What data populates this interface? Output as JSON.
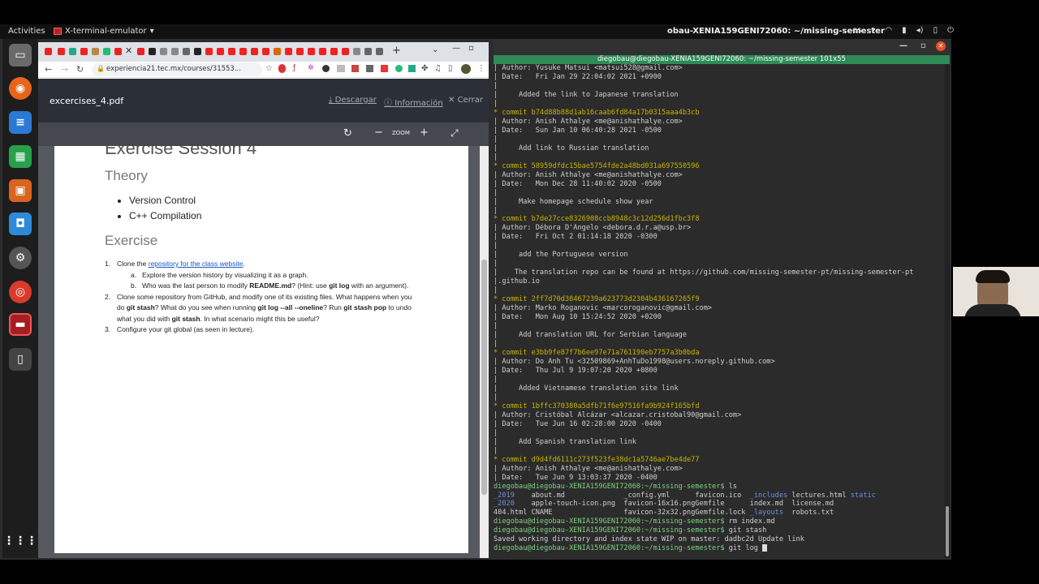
{
  "topbar": {
    "activities": "Activities",
    "app_name": "X-terminal-emulator",
    "terminal_title": "obau-XENIA159GENI72060: ~/missing-semester",
    "lang": "es"
  },
  "browser": {
    "url": "experiencia21.tec.mx/courses/31553...",
    "pdf": {
      "filename": "excercises_4.pdf",
      "download": "Descargar",
      "info": "Información",
      "close": "Cerrar",
      "zoom": "ZOOM",
      "page": {
        "session_title": "Exercise Session 4",
        "theory_heading": "Theory",
        "theory_items": [
          "Version Control",
          "C++ Compilation"
        ],
        "exercise_heading": "Exercise",
        "ex1_prefix": "Clone the ",
        "ex1_link": "repository for the class website",
        "ex1_suffix": ".",
        "ex1a": "Explore the version history by visualizing it as a graph.",
        "ex1b_pre": "Who was the last person to modify ",
        "ex1b_bold": "README.md",
        "ex1b_mid": "? (Hint: use ",
        "ex1b_bold2": "git log",
        "ex1b_post": " with an argument).",
        "ex2_a": "Clone some repository from GitHub, and modify one of its existing files. What happens when you do ",
        "ex2_b": "git stash",
        "ex2_c": "? What do you see when running ",
        "ex2_d": "git log --all --oneline",
        "ex2_e": "? Run ",
        "ex2_f": "git stash pop",
        "ex2_g": " to undo what you did with ",
        "ex2_h": "git stash",
        "ex2_i": ". In what scenario might this be useful?",
        "ex3": "Configure your git global (as seen in lecture)."
      }
    }
  },
  "terminal": {
    "tab_title": "diegobau@diegobau-XENIA159GENI72060: ~/missing-semester 101x55",
    "log": [
      {
        "author": "Yusuke Matsui <matsui528@gmail.com>",
        "date": "Fri Jan 29 22:04:02 2021 +0900",
        "message": "Added the link to Japanese translation",
        "head_only": true
      },
      {
        "commit": "b74d88b88d1ab16caab6fd84a17b0315aaa4b3cb",
        "author": "Anish Athalye <me@anishathalye.com>",
        "date": "Sun Jan 10 06:40:28 2021 -0500",
        "message": "Add link to Russian translation"
      },
      {
        "commit": "58959dfdc15bae5754fde2a48bd031a697550596",
        "author": "Anish Athalye <me@anishathalye.com>",
        "date": "Mon Dec 28 11:40:02 2020 -0500",
        "message": "Make homepage schedule show year"
      },
      {
        "commit": "b7de27cce8326908ccb8948c3c12d256d1fbc3f8",
        "author": "Débora D'Angelo <debora.d.r.a@usp.br>",
        "date": "Fri Oct 2 01:14:18 2020 -0300",
        "message": "add the Portuguese version",
        "extra": [
          "",
          "    The translation repo can be found at https://github.com/missing-semester-pt/missing-semester-pt",
          ".github.io"
        ]
      },
      {
        "commit": "2ff7d70d38467239a623773d2304b436167265f9",
        "author": "Marko Roganovic <marcoroganovic@gmail.com>",
        "date": "Mon Aug 10 15:24:52 2020 +0200",
        "message": "Add translation URL for Serbian language"
      },
      {
        "commit": "e3bb9fe87f7b6ee97e71a761190eb7757a3b0bda",
        "author": "Do Anh Tu <32509869+AnhTuDo1998@users.noreply.github.com>",
        "date": "Thu Jul 9 19:07:20 2020 +0800",
        "message": "Added Vietnamese translation site link"
      },
      {
        "commit": "1bffc370380a5dfb71f6e97516fa9b924f165bfd",
        "author": "Cristóbal Alcázar <alcazar.cristobal90@gmail.com>",
        "date": "Tue Jun 16 02:28:00 2020 -0400",
        "message": "Add Spanish translation link"
      },
      {
        "commit": "d9d4fd6111c273f523fe38dc1a5746ae7be4de77",
        "author": "Anish Athalye <me@anishathalye.com>",
        "date": "Tue Jun 9 13:03:37 2020 -0400",
        "message": "",
        "no_message": true
      }
    ],
    "prompt": "diegobau@diegobau-XENIA159GENI72060:~/missing-semester$",
    "commands": [
      "ls",
      "rm index.md",
      "git stash",
      "git log"
    ],
    "ls_rows": [
      [
        {
          "t": "_2019",
          "c": "blue"
        },
        {
          "t": "about.md"
        },
        {
          "t": "_config.yml"
        },
        {
          "t": "favicon.ico"
        },
        {
          "t": "_includes",
          "c": "blue"
        },
        {
          "t": "lectures.html"
        },
        {
          "t": "static",
          "c": "blue"
        }
      ],
      [
        {
          "t": "_2020",
          "c": "blue"
        },
        {
          "t": "apple-touch-icon.png"
        },
        {
          "t": "favicon-16x16.png"
        },
        {
          "t": "Gemfile"
        },
        {
          "t": "index.md"
        },
        {
          "t": "license.md"
        },
        {
          "t": ""
        }
      ],
      [
        {
          "t": "404.html"
        },
        {
          "t": "CNAME"
        },
        {
          "t": "favicon-32x32.png"
        },
        {
          "t": "Gemfile.lock"
        },
        {
          "t": "_layouts",
          "c": "blue"
        },
        {
          "t": "robots.txt"
        },
        {
          "t": ""
        }
      ]
    ],
    "stash_output": "Saved working directory and index state WIP on master: dadbc2d Update link"
  },
  "colors": {
    "terminal_bg": "#2b2b2b",
    "commit_yellow": "#c8b400",
    "prompt_green": "#7fd37f",
    "dir_blue": "#6f8fe8",
    "tab_green": "#2e8b57"
  }
}
